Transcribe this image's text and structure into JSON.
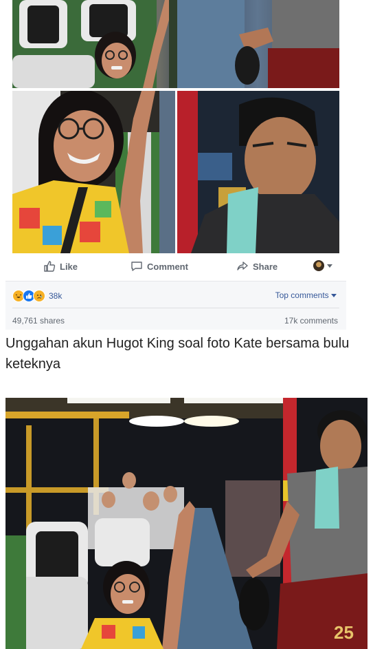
{
  "actions": {
    "like": "Like",
    "comment": "Comment",
    "share": "Share"
  },
  "reactions": {
    "icons": [
      "haha-icon",
      "like-icon",
      "sad-icon"
    ],
    "count": "38k",
    "top_comments": "Top comments",
    "shares": "49,761 shares",
    "comments": "17k comments"
  },
  "caption": "Unggahan akun Hugot King soal foto Kate bersama bulu keteknya",
  "colors": {
    "link": "#365899",
    "muted": "#606770",
    "panel": "#f6f7f9",
    "like": "#1877f2",
    "haha": "#f7b125"
  },
  "photos": {
    "jersey_number": "25"
  }
}
